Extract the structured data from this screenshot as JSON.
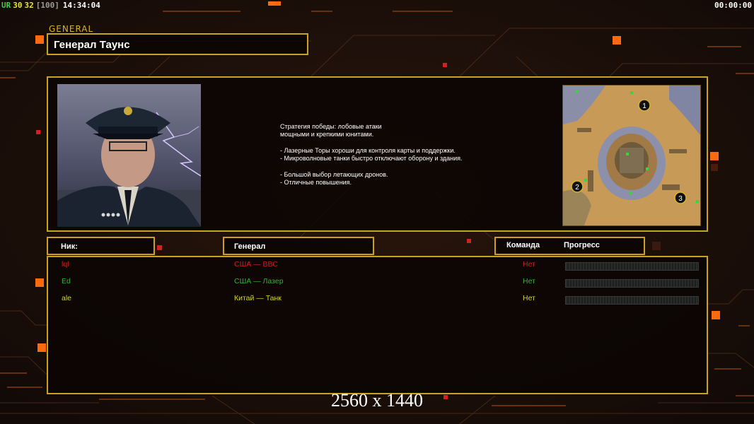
{
  "hud": {
    "left_segments": [
      {
        "text": "UR",
        "color": "#3bd23b"
      },
      {
        "text": "30",
        "color": "#e8e830"
      },
      {
        "text": "32",
        "color": "#e8e830"
      },
      {
        "text": "[100]",
        "color": "#9a9a9a"
      },
      {
        "text": "14:34:04",
        "color": "#ffffff"
      }
    ],
    "right_timer": "00:00:00"
  },
  "general": {
    "tag": "GENERAL",
    "name": "Генерал Таунс",
    "description": "Стратегия победы: лобовые атаки\nмощными и крепкими юнитами.\n\n- Лазерные Торы хороши для контроля карты и поддержки.\n- Микроволновые танки быстро отключают оборону и здания.\n\n- Большой выбор летающих дронов.\n- Отличные повышения."
  },
  "map": {
    "start_positions": [
      "1",
      "2",
      "3"
    ]
  },
  "table": {
    "headers": {
      "nick": "Ник:",
      "general": "Генерал",
      "team": "Команда",
      "progress": "Прогресс"
    },
    "rows": [
      {
        "nick": "lql",
        "general": "США — ВВС",
        "team": "Нет",
        "color": "#d41e1e",
        "progress": 0
      },
      {
        "nick": "Ed",
        "general": "США — Лазер",
        "team": "Нет",
        "color": "#2fb52f",
        "progress": 0
      },
      {
        "nick": "ale",
        "general": "Китай — Танк",
        "team": "Нет",
        "color": "#d6d62a",
        "progress": 0
      }
    ]
  },
  "resolution_label": "2560 x 1440",
  "colors": {
    "frame": "#c9a21e",
    "accent": "#ff6a10",
    "background": "#150c08"
  }
}
